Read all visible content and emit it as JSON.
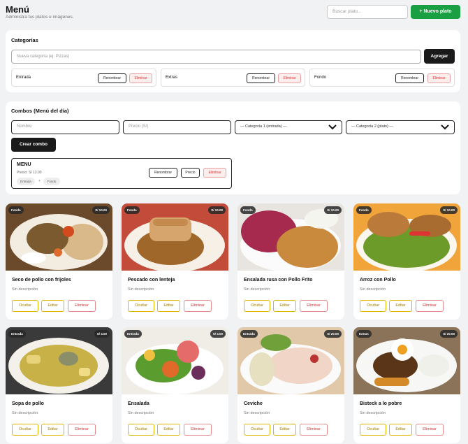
{
  "header": {
    "title": "Menú",
    "subtitle": "Administra tus platos e imágenes.",
    "search_placeholder": "Buscar plato...",
    "new_button": "+ Nuevo plato"
  },
  "categories": {
    "heading": "Categorías",
    "input_placeholder": "Nueva categoría (ej. Pizzas)",
    "add_button": "Agregar",
    "items": [
      {
        "name": "Entrada",
        "rename": "Renombrar",
        "delete": "Eliminar"
      },
      {
        "name": "Extras",
        "rename": "Renombrar",
        "delete": "Eliminar"
      },
      {
        "name": "Fondo",
        "rename": "Renombrar",
        "delete": "Eliminar"
      }
    ]
  },
  "combos": {
    "heading": "Combos (Menú del día)",
    "name_placeholder": "Nombre",
    "price_placeholder": "Precio (S/)",
    "select1": "— Categoría 1 (entrada) —",
    "select2": "— Categoría 2 (plato) —",
    "create_button": "Crear combo",
    "combo": {
      "name": "MENU",
      "price": "Precio: S/ 12.00",
      "tag1": "Entrada",
      "plus": "+",
      "tag2": "Fondo",
      "rename": "Renombrar",
      "price_btn": "Precio",
      "delete": "Eliminar"
    }
  },
  "dish_actions": {
    "hide": "Ocultar",
    "edit": "Editar",
    "delete": "Eliminar"
  },
  "dishes": [
    {
      "category": "Fondo",
      "price": "S/ 10.00",
      "name": "Seco de pollo con frijoles",
      "desc": "Sin descripción"
    },
    {
      "category": "Fondo",
      "price": "S/ 10.00",
      "name": "Pescado con lenteja",
      "desc": "Sin descripción"
    },
    {
      "category": "Fondo",
      "price": "S/ 10.00",
      "name": "Ensalada rusa con Pollo Frito",
      "desc": "Sin descripción"
    },
    {
      "category": "Fondo",
      "price": "S/ 10.00",
      "name": "Arroz con Pollo",
      "desc": "Sin descripción"
    },
    {
      "category": "Entrada",
      "price": "S/ 4.00",
      "name": "Sopa de pollo",
      "desc": "Sin descripción"
    },
    {
      "category": "Entrada",
      "price": "S/ 4.00",
      "name": "Ensalada",
      "desc": "Sin descripción"
    },
    {
      "category": "Entrada",
      "price": "S/ 20.00",
      "name": "Ceviche",
      "desc": "Sin descripción"
    },
    {
      "category": "Extras",
      "price": "S/ 20.00",
      "name": "Bisteck a lo pobre",
      "desc": "Sin descripción"
    }
  ]
}
